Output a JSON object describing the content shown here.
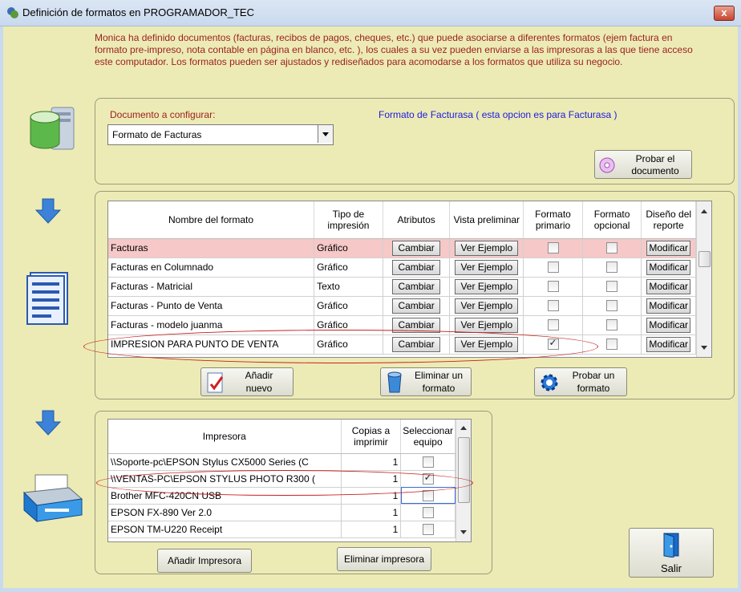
{
  "window": {
    "title": "Definición de formatos en PROGRAMADOR_TEC",
    "close_label": "x"
  },
  "intro": "Monica ha definido documentos (facturas, recibos de pagos, cheques, etc.) que puede asociarse a diferentes formatos (ejem factura en formato pre-impreso,  nota contable en página en blanco, etc. ), los cuales a su vez pueden enviarse a las impresoras a las que tiene acceso este computador.  Los formatos pueden ser ajustados y rediseñados para acomodarse a los formatos que utiliza su negocio.",
  "document": {
    "label": "Documento a configurar:",
    "selected": "Formato de Facturas",
    "info": "Formato de Facturasa ( esta opcion es para Facturasa )",
    "test_button": {
      "line1": "Probar el",
      "line2": "documento"
    }
  },
  "formats": {
    "headers": {
      "name": "Nombre del formato",
      "type": "Tipo de impresión",
      "attrs": "Atributos",
      "preview": "Vista preliminar",
      "primary": "Formato primario",
      "optional": "Formato opcional",
      "design": "Diseño del reporte"
    },
    "rows": [
      {
        "name": "Facturas",
        "type": "Gráfico",
        "attrs": "Cambiar",
        "preview": "Ver Ejemplo",
        "primary": false,
        "optional": false,
        "design": "Modificar"
      },
      {
        "name": "Facturas en Columnado",
        "type": "Gráfico",
        "attrs": "Cambiar",
        "preview": "Ver Ejemplo",
        "primary": false,
        "optional": false,
        "design": "Modificar"
      },
      {
        "name": "Facturas - Matricial",
        "type": "Texto",
        "attrs": "Cambiar",
        "preview": "Ver Ejemplo",
        "primary": false,
        "optional": false,
        "design": "Modificar"
      },
      {
        "name": "Facturas - Punto de Venta",
        "type": "Gráfico",
        "attrs": "Cambiar",
        "preview": "Ver Ejemplo",
        "primary": false,
        "optional": false,
        "design": "Modificar"
      },
      {
        "name": "Facturas - modelo juanma",
        "type": "Gráfico",
        "attrs": "Cambiar",
        "preview": "Ver Ejemplo",
        "primary": false,
        "optional": false,
        "design": "Modificar"
      },
      {
        "name": "IMPRESION PARA PUNTO DE VENTA",
        "type": "Gráfico",
        "attrs": "Cambiar",
        "preview": "Ver Ejemplo",
        "primary": true,
        "optional": false,
        "design": "Modificar"
      }
    ],
    "add_button": {
      "line1": "Añadir",
      "line2": "nuevo"
    },
    "delete_button": {
      "line1": "Eliminar un",
      "line2": "formato"
    },
    "test_button": {
      "line1": "Probar un",
      "line2": "formato"
    }
  },
  "printers": {
    "headers": {
      "printer": "Impresora",
      "copies": "Copias a imprimir",
      "select": "Seleccionar equipo"
    },
    "rows": [
      {
        "printer": "\\\\Soporte-pc\\EPSON Stylus CX5000 Series (C",
        "copies": "1",
        "selected": false
      },
      {
        "printer": "\\\\VENTAS-PC\\EPSON STYLUS PHOTO R300 (",
        "copies": "1",
        "selected": true
      },
      {
        "printer": "Brother MFC-420CN USB",
        "copies": "1",
        "selected": false
      },
      {
        "printer": "EPSON FX-890 Ver 2.0",
        "copies": "1",
        "selected": false
      },
      {
        "printer": "EPSON TM-U220 Receipt",
        "copies": "1",
        "selected": false
      }
    ],
    "add_button": "Añadir Impresora",
    "delete_button": "Eliminar impresora"
  },
  "exit_button": "Salir",
  "colors": {
    "background": "#ecebb5",
    "intro_text": "#9c1e1e",
    "info_text": "#1a1ae0",
    "highlight_row": "#f6c8c8",
    "annotation": "#c82020"
  }
}
